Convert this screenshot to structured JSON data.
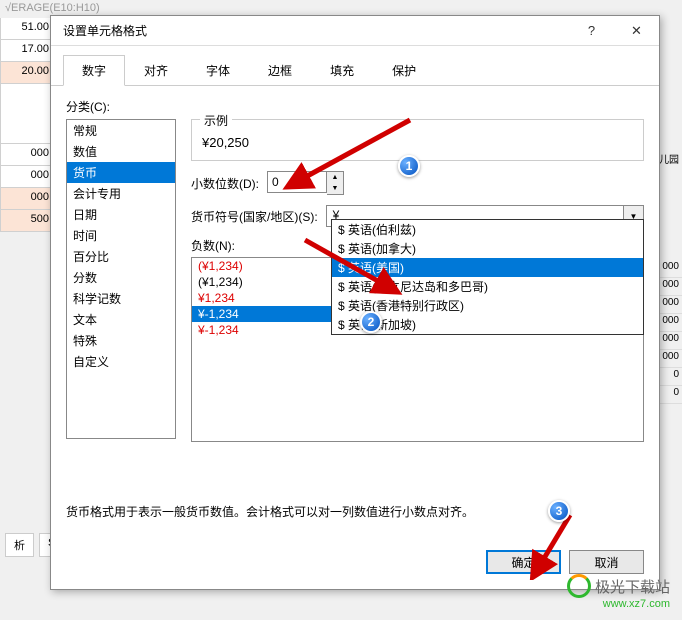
{
  "background": {
    "formula_bar": "√ERAGE(E10:H10)",
    "cells": [
      "51.00",
      "17.00",
      "20.00",
      "000",
      "000",
      "000",
      "500"
    ],
    "right_label": "儿园",
    "right_cells": [
      "000",
      "000",
      "000",
      "000",
      "000",
      "000",
      "0",
      "0"
    ],
    "bottom_tabs": [
      "析",
      "S"
    ]
  },
  "dialog": {
    "title": "设置单元格格式",
    "help_aria": "帮助",
    "close_aria": "关闭"
  },
  "tabs": [
    "数字",
    "对齐",
    "字体",
    "边框",
    "填充",
    "保护"
  ],
  "category": {
    "label": "分类(C):",
    "items": [
      "常规",
      "数值",
      "货币",
      "会计专用",
      "日期",
      "时间",
      "百分比",
      "分数",
      "科学记数",
      "文本",
      "特殊",
      "自定义"
    ],
    "selected": "货币"
  },
  "example": {
    "legend": "示例",
    "value": "¥20,250"
  },
  "decimal": {
    "label": "小数位数(D):",
    "value": "0"
  },
  "symbol": {
    "label": "货币符号(国家/地区)(S):",
    "value": "¥",
    "options": [
      "$ 英语(伯利兹)",
      "$ 英语(加拿大)",
      "$ 英语(美国)",
      "$ 英语(特立尼达岛和多巴哥)",
      "$ 英语(香港特别行政区)",
      "$ 英语(新加坡)"
    ],
    "highlighted": "$ 英语(美国)"
  },
  "negative": {
    "label": "负数(N):",
    "items": [
      {
        "text": "(¥1,234)",
        "red": true,
        "selected": false
      },
      {
        "text": "(¥1,234)",
        "red": false,
        "selected": false
      },
      {
        "text": "¥1,234",
        "red": true,
        "selected": false
      },
      {
        "text": "¥-1,234",
        "red": false,
        "selected": true
      },
      {
        "text": "¥-1,234",
        "red": true,
        "selected": false
      }
    ]
  },
  "description": "货币格式用于表示一般货币数值。会计格式可以对一列数值进行小数点对齐。",
  "buttons": {
    "ok": "确定",
    "cancel": "取消"
  },
  "callouts": [
    "1",
    "2",
    "3"
  ],
  "watermark": {
    "text": "极光下载站",
    "url": "www.xz7.com"
  }
}
